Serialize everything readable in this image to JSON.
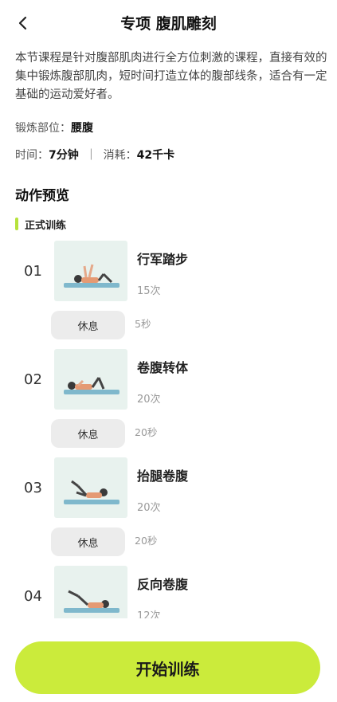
{
  "header": {
    "title": "专项 腹肌雕刻",
    "back_icon": "chevron-left-icon"
  },
  "description": "本节课程是针对腹部肌肉进行全方位刺激的课程，直接有效的集中锻炼腹部肌肉，短时间打造立体的腹部线条，适合有一定基础的运动爱好者。",
  "meta": {
    "part_label": "锻炼部位：",
    "part_value": "腰腹",
    "time_label": "时间：",
    "time_value": "7分钟",
    "separator": "｜",
    "calorie_label": "消耗：",
    "calorie_value": "42千卡"
  },
  "section_title": "动作预览",
  "subsection": {
    "label": "正式训练",
    "accent": "#b6e23c"
  },
  "exercises": [
    {
      "num": "01",
      "name": "行军踏步",
      "count": "15次",
      "rest_label": "休息",
      "rest_duration": "5秒"
    },
    {
      "num": "02",
      "name": "卷腹转体",
      "count": "20次",
      "rest_label": "休息",
      "rest_duration": "20秒"
    },
    {
      "num": "03",
      "name": "抬腿卷腹",
      "count": "20次",
      "rest_label": "休息",
      "rest_duration": "20秒"
    },
    {
      "num": "04",
      "name": "反向卷腹",
      "count": "12次"
    }
  ],
  "start_button": {
    "label": "开始训练",
    "color": "#cbeb3b"
  }
}
